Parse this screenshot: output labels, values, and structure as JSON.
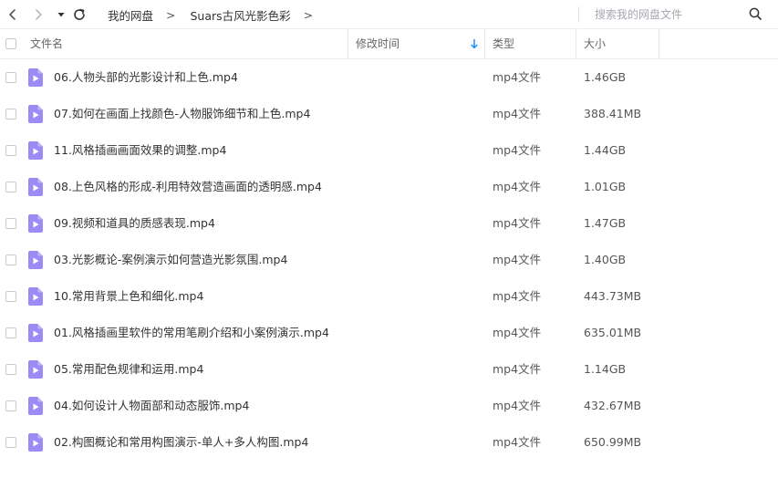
{
  "toolbar": {
    "breadcrumb": [
      "我的网盘",
      "Suars古风光影色彩"
    ],
    "separator": ">",
    "search_placeholder": "搜索我的网盘文件"
  },
  "columns": {
    "name": "文件名",
    "modified": "修改时间",
    "type": "类型",
    "size": "大小"
  },
  "files": [
    {
      "name": "06.人物头部的光影设计和上色.mp4",
      "type": "mp4文件",
      "size": "1.46GB"
    },
    {
      "name": "07.如何在画面上找颜色-人物服饰细节和上色.mp4",
      "type": "mp4文件",
      "size": "388.41MB"
    },
    {
      "name": "11.风格插画画面效果的调整.mp4",
      "type": "mp4文件",
      "size": "1.44GB"
    },
    {
      "name": "08.上色风格的形成-利用特效营造画面的透明感.mp4",
      "type": "mp4文件",
      "size": "1.01GB"
    },
    {
      "name": "09.视频和道具的质感表现.mp4",
      "type": "mp4文件",
      "size": "1.47GB"
    },
    {
      "name": "03.光影概论-案例演示如何营造光影氛围.mp4",
      "type": "mp4文件",
      "size": "1.40GB"
    },
    {
      "name": "10.常用背景上色和细化.mp4",
      "type": "mp4文件",
      "size": "443.73MB"
    },
    {
      "name": "01.风格插画里软件的常用笔刷介绍和小案例演示.mp4",
      "type": "mp4文件",
      "size": "635.01MB"
    },
    {
      "name": "05.常用配色规律和运用.mp4",
      "type": "mp4文件",
      "size": "1.14GB"
    },
    {
      "name": "04.如何设计人物面部和动态服饰.mp4",
      "type": "mp4文件",
      "size": "432.67MB"
    },
    {
      "name": "02.构图概论和常用构图演示-单人+多人构图.mp4",
      "type": "mp4文件",
      "size": "650.99MB"
    }
  ],
  "colors": {
    "video_icon": "#9b8cf5",
    "sort_arrow": "#1e90ff"
  },
  "icons": {
    "back": "chevron-left-icon",
    "forward": "chevron-right-icon",
    "history": "caret-down-icon",
    "refresh": "refresh-icon",
    "search": "search-icon",
    "file": "video-file-icon",
    "sort": "sort-arrow-down-icon"
  }
}
